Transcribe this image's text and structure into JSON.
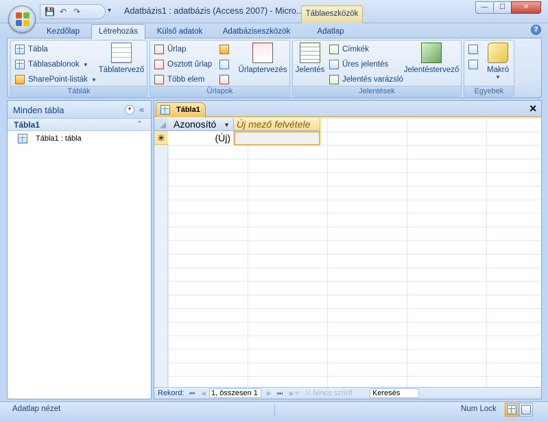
{
  "window": {
    "title": "Adatbázis1 : adatbázis (Access 2007) - Micro...",
    "context_tab": "Táblaeszközök",
    "controls": {
      "minimize": "—",
      "maximize": "☐",
      "close": "✕"
    },
    "help": "?"
  },
  "quick_access": {
    "save": "💾",
    "undo": "↶",
    "redo": "↷",
    "customize": "▾"
  },
  "tabs": [
    "Kezdőlap",
    "Létrehozás",
    "Külső adatok",
    "Adatbáziseszközök",
    "Adatlap"
  ],
  "active_tab": "Létrehozás",
  "ribbon": {
    "tables": {
      "label": "Táblák",
      "tabla": "Tábla",
      "tablasablonok": "Táblasablonok",
      "sharepoint": "SharePoint-listák",
      "tablatervezo": "Táblatervező"
    },
    "forms": {
      "label": "Űrlapok",
      "urlap": "Űrlap",
      "osztott": "Osztott űrlap",
      "tobb": "Több elem",
      "urlaptervezes": "Űrlaptervezés"
    },
    "reports": {
      "label": "Jelentések",
      "jelentes": "Jelentés",
      "cimkek": "Címkék",
      "ures": "Üres jelentés",
      "varazslo": "Jelentés varázsló",
      "jelentestervezo": "Jelentéstervező"
    },
    "other": {
      "label": "Egyebek",
      "makro": "Makró"
    }
  },
  "nav": {
    "title": "Minden tábla",
    "collapse": "«",
    "group": "Tábla1",
    "group_chevron": "⌃",
    "items": [
      "Tábla1 : tábla"
    ]
  },
  "doc": {
    "tab": "Tábla1",
    "close": "✕",
    "columns": {
      "id": "Azonosító",
      "add": "Új mező felvétele"
    },
    "new_row_marker": "✳",
    "new_row_value": "(Új)"
  },
  "record_nav": {
    "label": "Rekord:",
    "first": "⏮",
    "prev": "◀",
    "position": "1, összesen 1",
    "next": "▶",
    "last": "⏭",
    "new": "▶✳",
    "filter": "Nincs szűrő",
    "search": "Keresés"
  },
  "status": {
    "view": "Adatlap nézet",
    "numlock": "Num Lock"
  },
  "colors": {
    "accent": "#f2b445",
    "ribbon_text": "#15428b"
  }
}
